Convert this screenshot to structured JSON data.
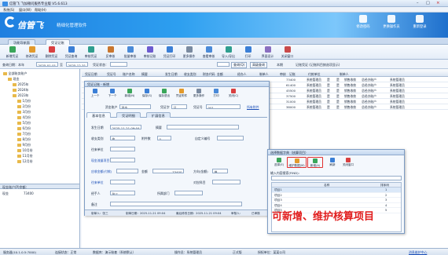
{
  "window": {
    "title": "信管飞 飞加顿问服务专业版 V5.6.613"
  },
  "menu": [
    "系统(S)",
    "窗口(W)",
    "帮助(H)"
  ],
  "banner": {
    "brand": "信管飞",
    "slogan": "精细化管理软件",
    "buttons": [
      "修改密码",
      "更换操作员",
      "重新登录"
    ]
  },
  "tabs": [
    "功能导航面",
    "凭证记账"
  ],
  "toolbar": [
    "新增凭证",
    "修改凭证",
    "删除凭证",
    "凭证查询",
    "审核凭证",
    "反审核",
    "批量审核",
    "审核记账",
    "凭证打印",
    "更多操作",
    "查看审核",
    "导入/导出",
    "打印",
    "界面设计",
    "关闭窗口"
  ],
  "filter": {
    "query_label": "查询日期：本年",
    "date_from": "2025-01-01",
    "to": "至",
    "date_to": "2025-12-31",
    "voucher_label": "凭证状态：",
    "btn_query": "查询(Q)",
    "btn_senior": "高级查询",
    "check_label": "本期",
    "note": "记账凭证 (记账科目按选项显示)"
  },
  "tree": {
    "root": "全部账务账户",
    "items": [
      "现金",
      "2025年",
      "2024年",
      "2023年",
      "1月份",
      "2月份",
      "3月份",
      "4月份",
      "5月份",
      "6月份",
      "7月份",
      "8月份",
      "9月份",
      "10月份",
      "11月份",
      "12月份"
    ],
    "panel_title": "现金账户(P)余额：",
    "panel_rows": [
      {
        "name": "现金",
        "value": "73400"
      }
    ]
  },
  "grid": {
    "headers": [
      "凭证日期",
      "凭证号",
      "账户名称",
      "摘要",
      "发生日期",
      "收支类别",
      "财务代码",
      "金额",
      "经办人",
      "制单人",
      "审核",
      "记账",
      "付款单位",
      "制单人"
    ],
    "rows": [
      {
        "amt": "73400",
        "maker": "系统管理员",
        "s": "是",
        "j": "是",
        "unit": "销售收款",
        "payer": "总经办账户",
        "m2": "系统管理员"
      },
      {
        "amt": "61400",
        "maker": "系统管理员",
        "s": "是",
        "j": "是",
        "unit": "销售收款",
        "payer": "总经办账户",
        "m2": "系统管理员"
      },
      {
        "amt": "45500",
        "maker": "系统管理员",
        "s": "是",
        "j": "是",
        "unit": "销售收款",
        "payer": "总经办账户",
        "m2": "系统管理员"
      },
      {
        "amt": "37500",
        "maker": "系统管理员",
        "s": "是",
        "j": "是",
        "unit": "销售收款",
        "payer": "总经办账户",
        "m2": "系统管理员"
      },
      {
        "amt": "31000",
        "maker": "系统管理员",
        "s": "是",
        "j": "是",
        "unit": "销售收款",
        "payer": "总经办账户",
        "m2": "系统管理员"
      },
      {
        "amt": "38000",
        "maker": "系统管理员",
        "s": "是",
        "j": "是",
        "unit": "销售收款",
        "payer": "总经办账户",
        "m2": "系统管理员"
      }
    ]
  },
  "voucher_dialog": {
    "title": "凭证记账 - 新增",
    "toolbar": [
      "上一个",
      "下一个",
      "新增(N)",
      "保存(S)",
      "保存退出",
      "凭证附件",
      "更多操作",
      "打印",
      "关闭(C)"
    ],
    "account_label": "资金账户",
    "account_value": "现金",
    "voucher_label": "凭证字",
    "voucher_value": "记",
    "voucher_no_label": "凭证号",
    "voucher_no": "001",
    "link": "所有附件",
    "tabs": [
      "基本信息",
      "凭证明细",
      "扩展信息"
    ],
    "fields": {
      "date_label": "发生日期",
      "date_value": "2025-11-21 09:04",
      "summary_label": "摘要",
      "cat_label": "收支类别",
      "cat_value": "收",
      "attach_label": "附件数",
      "attach_value": "0",
      "custom_label": "自定义编号",
      "contact_label": "往来单位",
      "flow_label": "现金流量项目",
      "amount_label": "应收金额(付款)",
      "amount_value": "73400",
      "money_label": "金额",
      "dir_label": "方向(金额)",
      "dir_value": "借",
      "project_label": "往来单位",
      "ref_label": "对应科目",
      "handler_label": "经手人",
      "handler_value": "张三",
      "dept_label": "所属部门",
      "note_label": "备注"
    },
    "footer": {
      "maker": "制单人：张三",
      "make_time": "制单日期：2025-11-21 09:04",
      "modified": "最后修改日期：2025-11-21 09:04",
      "reviewer": "审核人：",
      "audit_check": "已审核"
    }
  },
  "item_dialog": {
    "title": "选择数据字典（核算项目）",
    "toolbar": [
      "选择(E)",
      "维护数据(M)",
      "新增(A)",
      "刷新",
      "关闭窗口"
    ],
    "search_label": "输入内容搜索(FIND):",
    "headers": [
      "",
      "名称",
      "排序码"
    ],
    "rows": [
      {
        "name": "项目1",
        "sort": "1"
      },
      {
        "name": "项目2",
        "sort": "2"
      },
      {
        "name": "项目3",
        "sort": "3"
      },
      {
        "name": "项目4",
        "sort": "4"
      },
      {
        "name": "项目5",
        "sort": "5"
      }
    ]
  },
  "annotation": "可新增、维护核算项目",
  "status": {
    "server": "服务器(10.1.0.5:7000)",
    "conn": "连接状态：正常",
    "db": "数据库：演示账套（系统默认）",
    "user": "操作员：系统管理员",
    "edition": "正式版",
    "company": "授权单位：某某公司",
    "link": "消息维护中心"
  }
}
